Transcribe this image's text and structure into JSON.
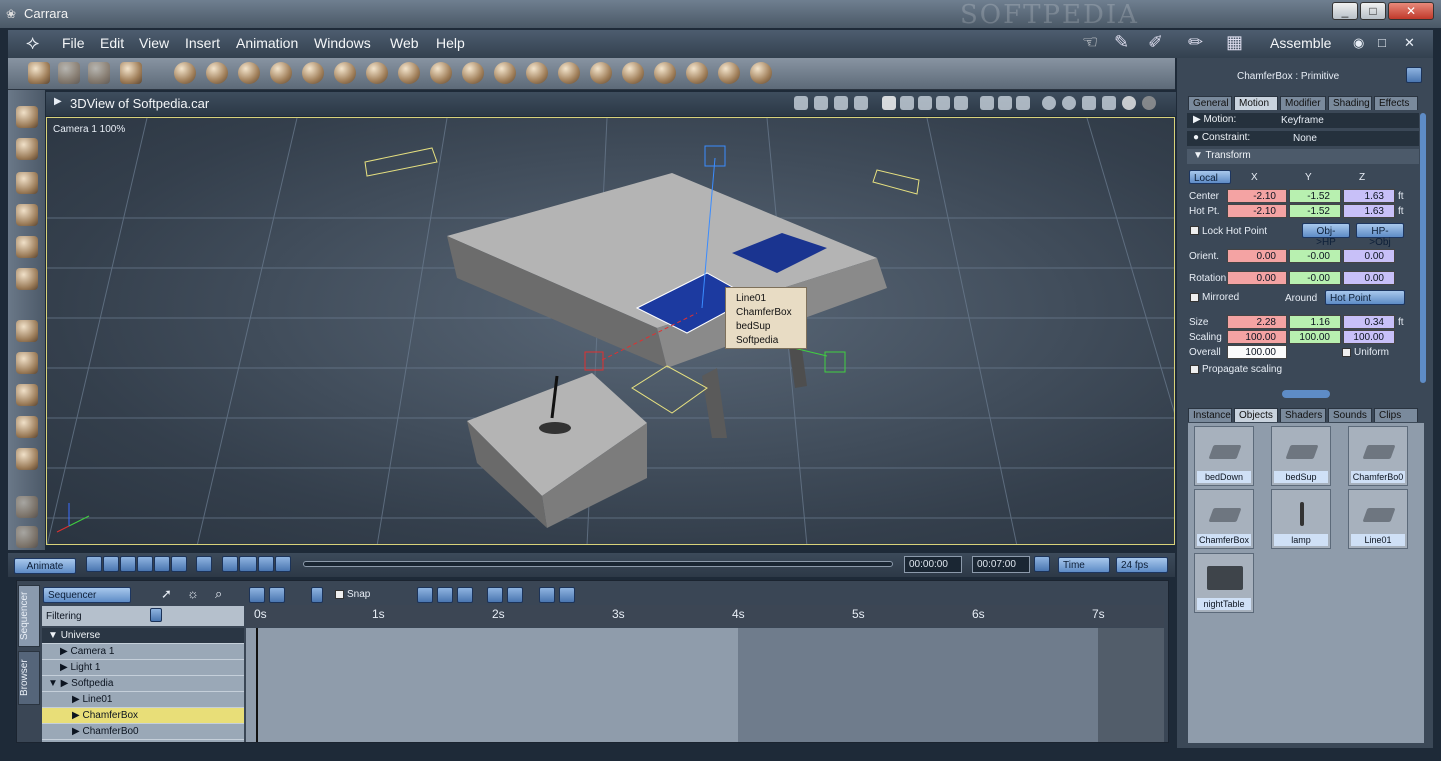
{
  "window": {
    "title": "Carrara",
    "watermark": "SOFTPEDIA",
    "controls": [
      "_",
      "□",
      "✕"
    ]
  },
  "menu": {
    "items": [
      "File",
      "Edit",
      "View",
      "Insert",
      "Animation",
      "Windows",
      "Web",
      "Help"
    ],
    "room": "Assemble"
  },
  "viewport": {
    "title": "3DView of Softpedia.car",
    "camera_label": "Camera 1 100%",
    "popup": [
      "Line01",
      "ChamferBox",
      "bedSup",
      "Softpedia"
    ]
  },
  "timeline": {
    "animate_label": "Animate",
    "current_time": "00:00:00",
    "end_time": "00:07:00",
    "time_mode": "Time",
    "fps": "24 fps"
  },
  "sequencer": {
    "mode": "Sequencer",
    "filtering": "Filtering",
    "snap": "Snap",
    "side_tabs": [
      "Sequencer",
      "Browser"
    ],
    "ruler": [
      "0s",
      "1s",
      "2s",
      "3s",
      "4s",
      "5s",
      "6s",
      "7s"
    ],
    "tree": [
      "Universe",
      "Camera 1",
      "Light 1",
      "Softpedia",
      "Line01",
      "ChamferBox",
      "ChamferBo0"
    ]
  },
  "properties": {
    "header": "ChamferBox : Primitive",
    "tabs": [
      "General",
      "Motion",
      "Modifier",
      "Shading",
      "Effects"
    ],
    "motion": {
      "label": "Motion:",
      "value": "Keyframe"
    },
    "constraint": {
      "label": "Constraint:",
      "value": "None"
    },
    "transform_label": "Transform",
    "space": "Local",
    "cols": [
      "X",
      "Y",
      "Z"
    ],
    "center": {
      "label": "Center",
      "x": "-2.10",
      "y": "-1.52",
      "z": "1.63",
      "unit": "ft"
    },
    "hotpt": {
      "label": "Hot Pt.",
      "x": "-2.10",
      "y": "-1.52",
      "z": "1.63",
      "unit": "ft"
    },
    "lock_hot_point": "Lock Hot Point",
    "obj_hp": "Obj->HP",
    "hp_obj": "HP->Obj",
    "orient": {
      "label": "Orient.",
      "x": "0.00",
      "y": "-0.00",
      "z": "0.00"
    },
    "rotation": {
      "label": "Rotation",
      "x": "0.00",
      "y": "-0.00",
      "z": "0.00"
    },
    "mirrored": "Mirrored",
    "around_label": "Around",
    "around": "Hot Point",
    "size": {
      "label": "Size",
      "x": "2.28",
      "y": "1.16",
      "z": "0.34",
      "unit": "ft"
    },
    "scaling": {
      "label": "Scaling",
      "x": "100.00",
      "y": "100.00",
      "z": "100.00"
    },
    "overall": {
      "label": "Overall",
      "value": "100.00"
    },
    "uniform": "Uniform",
    "propagate": "Propagate scaling"
  },
  "browser": {
    "tabs": [
      "Instance",
      "Objects",
      "Shaders",
      "Sounds",
      "Clips"
    ],
    "objects": [
      "bedDown",
      "bedSup",
      "ChamferBo0",
      "ChamferBox",
      "lamp",
      "Line01",
      "nightTable"
    ]
  }
}
